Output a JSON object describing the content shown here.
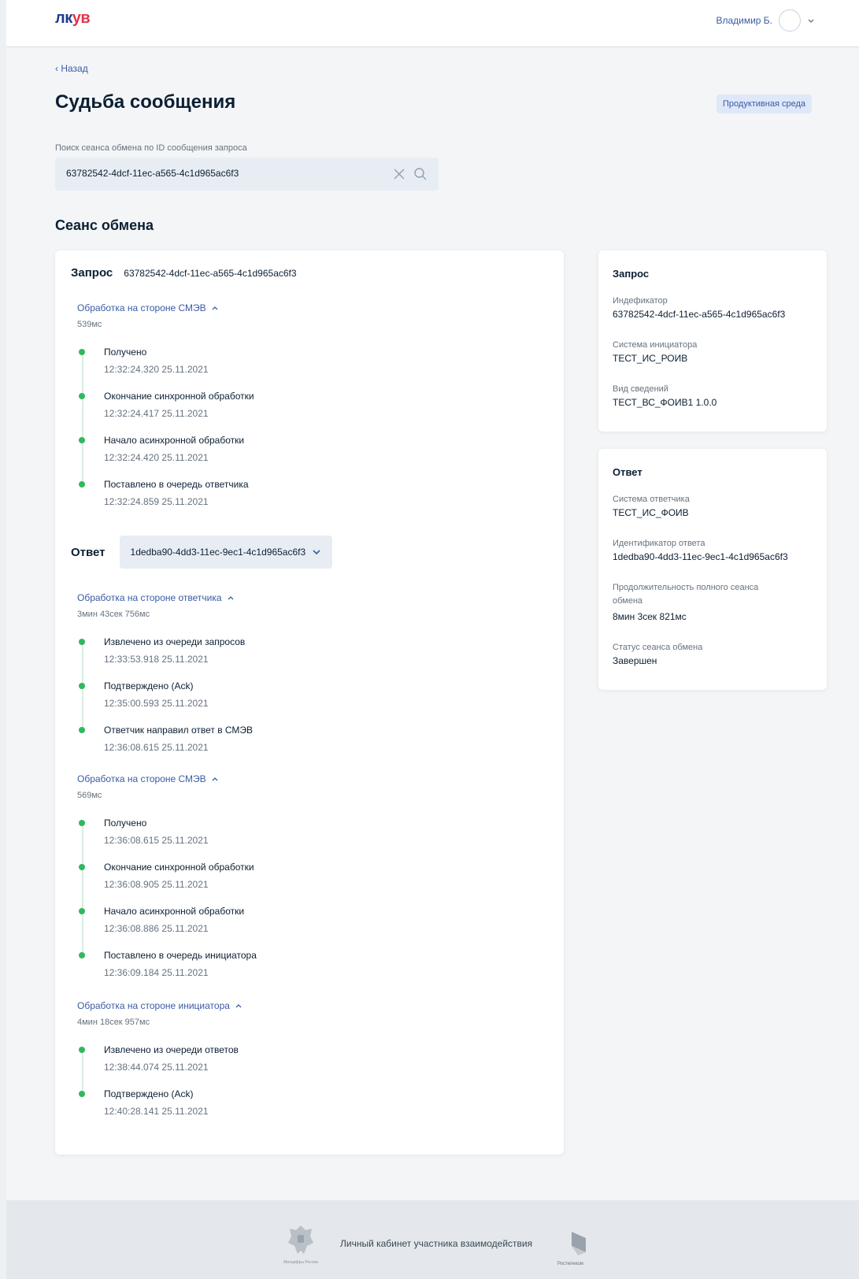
{
  "header": {
    "logo_part1": "лк",
    "logo_part2": "ув",
    "user_name": "Владимир Б."
  },
  "nav": {
    "back_label": "‹ Назад"
  },
  "page": {
    "title": "Судьба сообщения",
    "environment_badge": "Продуктивная среда"
  },
  "search": {
    "label": "Поиск сеанса обмена по ID сообщения запроса",
    "value": "63782542-4dcf-11ec-a565-4c1d965ac6f3"
  },
  "section_title": "Сеанс обмена",
  "request": {
    "label": "Запрос",
    "id": "63782542-4dcf-11ec-a565-4c1d965ac6f3",
    "stage": {
      "title": "Обработка на стороне СМЭВ",
      "duration": "539мс",
      "events": [
        {
          "name": "Получено",
          "time": "12:32:24.320 25.11.2021"
        },
        {
          "name": "Окончание синхронной обработки",
          "time": "12:32:24.417 25.11.2021"
        },
        {
          "name": "Начало асинхронной обработки",
          "time": "12:32:24.420 25.11.2021"
        },
        {
          "name": "Поставлено в очередь ответчика",
          "time": "12:32:24.859 25.11.2021"
        }
      ]
    }
  },
  "response": {
    "label": "Ответ",
    "selected_id": "1dedba90-4dd3-11ec-9ec1-4c1d965ac6f3",
    "stages": [
      {
        "title": "Обработка на стороне ответчика",
        "duration": "3мин 43сек 756мс",
        "events": [
          {
            "name": "Извлечено из очереди запросов",
            "time": "12:33:53.918 25.11.2021"
          },
          {
            "name": "Подтверждено (Ack)",
            "time": "12:35:00.593 25.11.2021"
          },
          {
            "name": "Ответчик направил ответ в СМЭВ",
            "time": "12:36:08.615 25.11.2021"
          }
        ]
      },
      {
        "title": "Обработка на стороне СМЭВ",
        "duration": "569мс",
        "events": [
          {
            "name": "Получено",
            "time": "12:36:08.615 25.11.2021"
          },
          {
            "name": "Окончание синхронной обработки",
            "time": "12:36:08.905 25.11.2021"
          },
          {
            "name": "Начало асинхронной обработки",
            "time": "12:36:08.886 25.11.2021"
          },
          {
            "name": "Поставлено в очередь инициатора",
            "time": "12:36:09.184 25.11.2021"
          }
        ]
      },
      {
        "title": "Обработка на стороне инициатора",
        "duration": "4мин 18сек 957мс",
        "events": [
          {
            "name": "Извлечено из очереди ответов",
            "time": "12:38:44.074 25.11.2021"
          },
          {
            "name": "Подтверждено (Ack)",
            "time": "12:40:28.141 25.11.2021"
          }
        ]
      }
    ]
  },
  "request_info": {
    "title": "Запрос",
    "fields": [
      {
        "label": "Индефикатор",
        "value": "63782542-4dcf-11ec-a565-4c1d965ac6f3"
      },
      {
        "label": "Система инициатора",
        "value": "ТЕСТ_ИС_РОИВ"
      },
      {
        "label": "Вид сведений",
        "value": "ТЕСТ_ВС_ФОИВ1 1.0.0"
      }
    ]
  },
  "response_info": {
    "title": "Ответ",
    "fields": [
      {
        "label": "Система ответчика",
        "value": "ТЕСТ_ИС_ФОИВ"
      },
      {
        "label": "Идентификатор ответа",
        "value": "1dedba90-4dd3-11ec-9ec1-4c1d965ac6f3"
      },
      {
        "label": "Продолжительность полного сеанса обмена",
        "value": "8мин 3сек 821мс"
      },
      {
        "label": "Статус сеанса обмена",
        "value": "Завершен"
      }
    ]
  },
  "footer": {
    "text": "Личный кабинет участника взаимодействия",
    "emblem_caption": "Минцифры России",
    "rostelecom_caption": "Ростелеком"
  },
  "colors": {
    "accent": "#3a5ba5",
    "logo_red": "#e2344b",
    "timeline_dot": "#32b760"
  }
}
